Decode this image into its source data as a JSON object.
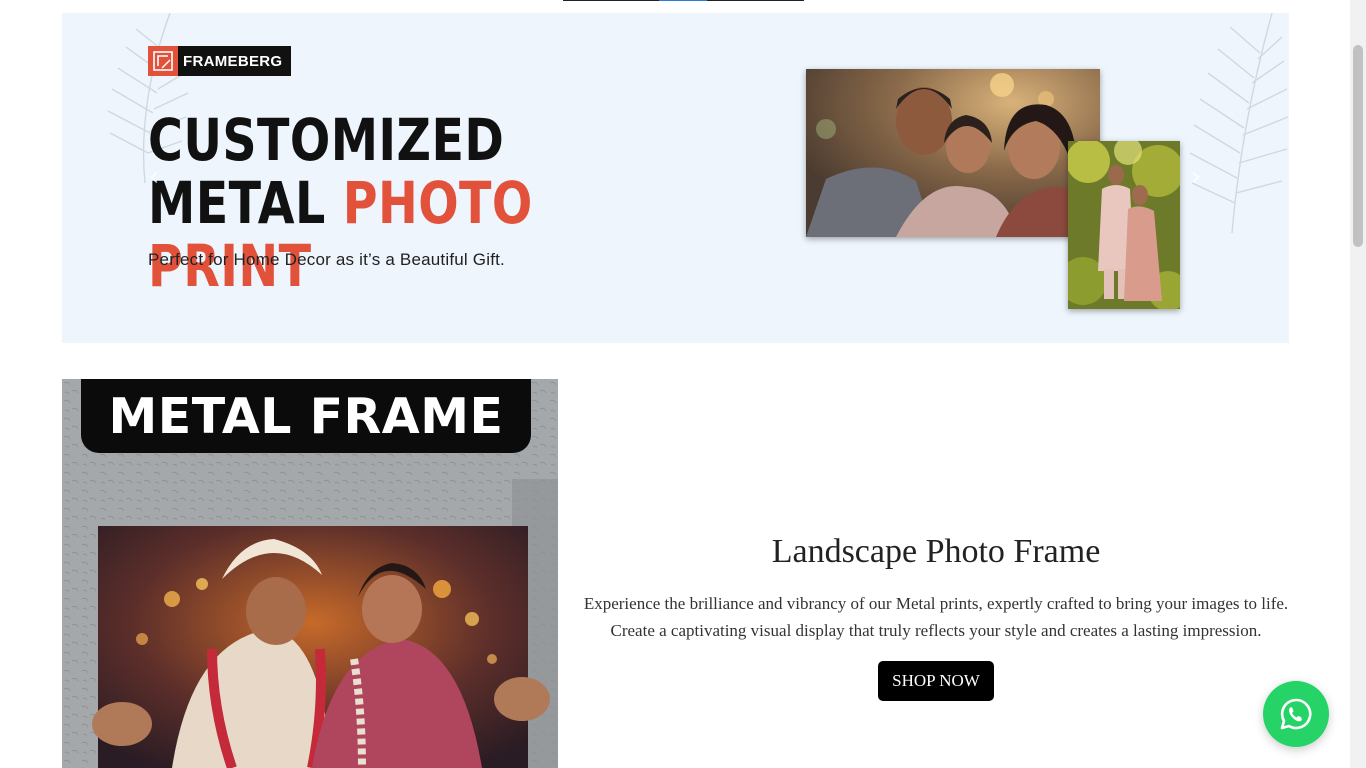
{
  "banner": {
    "brand": "FRAMEBERG",
    "headline_part1": "CUSTOMIZED METAL",
    "headline_accent": "PHOTO PRINT",
    "tagline": "Perfect for Home Decor as it’s a Beautiful Gift.",
    "prev_arrow": "‹",
    "next_arrow": "›"
  },
  "product": {
    "image_label": "METAL FRAME",
    "title": "Landscape Photo Frame",
    "description": "Experience the brilliance and vibrancy of our Metal prints, expertly crafted to bring your images to life. Create a captivating visual display that truly reflects your style and creates a lasting impression.",
    "button_label": "SHOP NOW"
  },
  "colors": {
    "accent": "#e2513a",
    "banner_bg": "#eef5fd",
    "whatsapp": "#25d366",
    "button_bg": "#000000"
  },
  "icons": {
    "whatsapp": "whatsapp-icon",
    "prev": "chevron-left-icon",
    "next": "chevron-right-icon"
  }
}
